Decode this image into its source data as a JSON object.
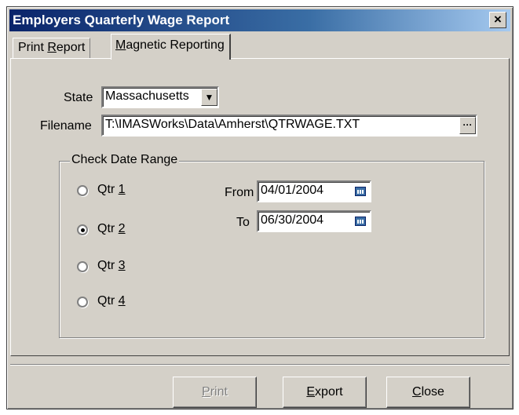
{
  "window": {
    "title": "Employers Quarterly Wage Report",
    "close_glyph": "×"
  },
  "tabs": [
    {
      "label_pre": "Print ",
      "label_key": "R",
      "label_post": "eport"
    },
    {
      "label_pre": "",
      "label_key": "M",
      "label_post": "agnetic Reporting"
    }
  ],
  "form": {
    "state_label": "State",
    "state_value": "Massachusetts",
    "filename_label": "Filename",
    "filename_value": "T:\\IMASWorks\\Data\\Amherst\\QTRWAGE.TXT",
    "browse_glyph": "···"
  },
  "date_range": {
    "title": "Check Date Range",
    "quarters": [
      {
        "label_pre": "Qtr ",
        "label_key": "1",
        "selected": false
      },
      {
        "label_pre": "Qtr ",
        "label_key": "2",
        "selected": true
      },
      {
        "label_pre": "Qtr ",
        "label_key": "3",
        "selected": false
      },
      {
        "label_pre": "Qtr ",
        "label_key": "4",
        "selected": false
      }
    ],
    "from_label": "From",
    "from_value": "04/01/2004",
    "to_label": "To",
    "to_value": "06/30/2004"
  },
  "buttons": {
    "print_key": "P",
    "print_rest": "rint",
    "export_key": "E",
    "export_rest": "xport",
    "close_key": "C",
    "close_rest": "lose"
  }
}
